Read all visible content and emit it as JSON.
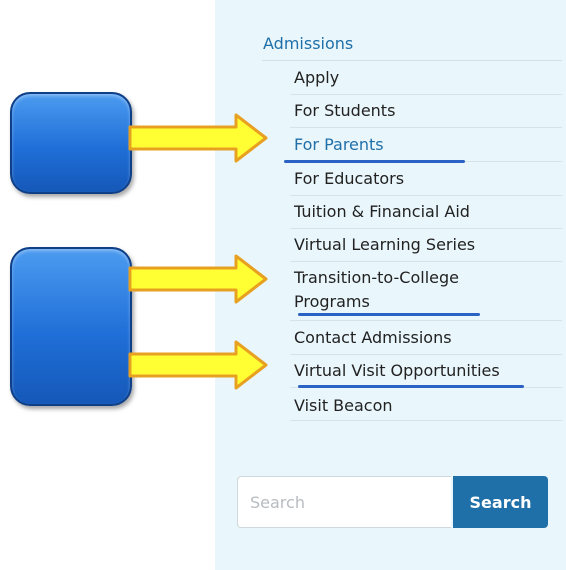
{
  "nav": {
    "title": "Admissions",
    "items": [
      {
        "label": "Apply"
      },
      {
        "label": "For Students"
      },
      {
        "label": "For Parents"
      },
      {
        "label": "For Educators"
      },
      {
        "label": "Tuition & Financial Aid"
      },
      {
        "label": "Virtual Learning Series"
      },
      {
        "label": "Transition-to-College Programs"
      },
      {
        "label": "Contact Admissions"
      },
      {
        "label": "Virtual Visit Opportunities"
      },
      {
        "label": "Visit Beacon"
      }
    ]
  },
  "search": {
    "placeholder": "Search",
    "button_label": "Search"
  },
  "colors": {
    "panel_background": "#e9f6fb",
    "link_blue": "#1f6fa8",
    "underline_blue": "#2a63c4",
    "arrow_fill": "#ffff33",
    "arrow_stroke": "#e8a020",
    "box_blue": "#1f6fd8"
  },
  "annotations": {
    "boxes": [
      "rounded-blue-box",
      "rounded-blue-box"
    ],
    "arrows": [
      "arrow-to-for-parents",
      "arrow-to-transition-to-college",
      "arrow-to-virtual-visit"
    ],
    "underlined_items": [
      "For Parents",
      "Transition-to-College Programs",
      "Virtual Visit Opportunities"
    ]
  }
}
